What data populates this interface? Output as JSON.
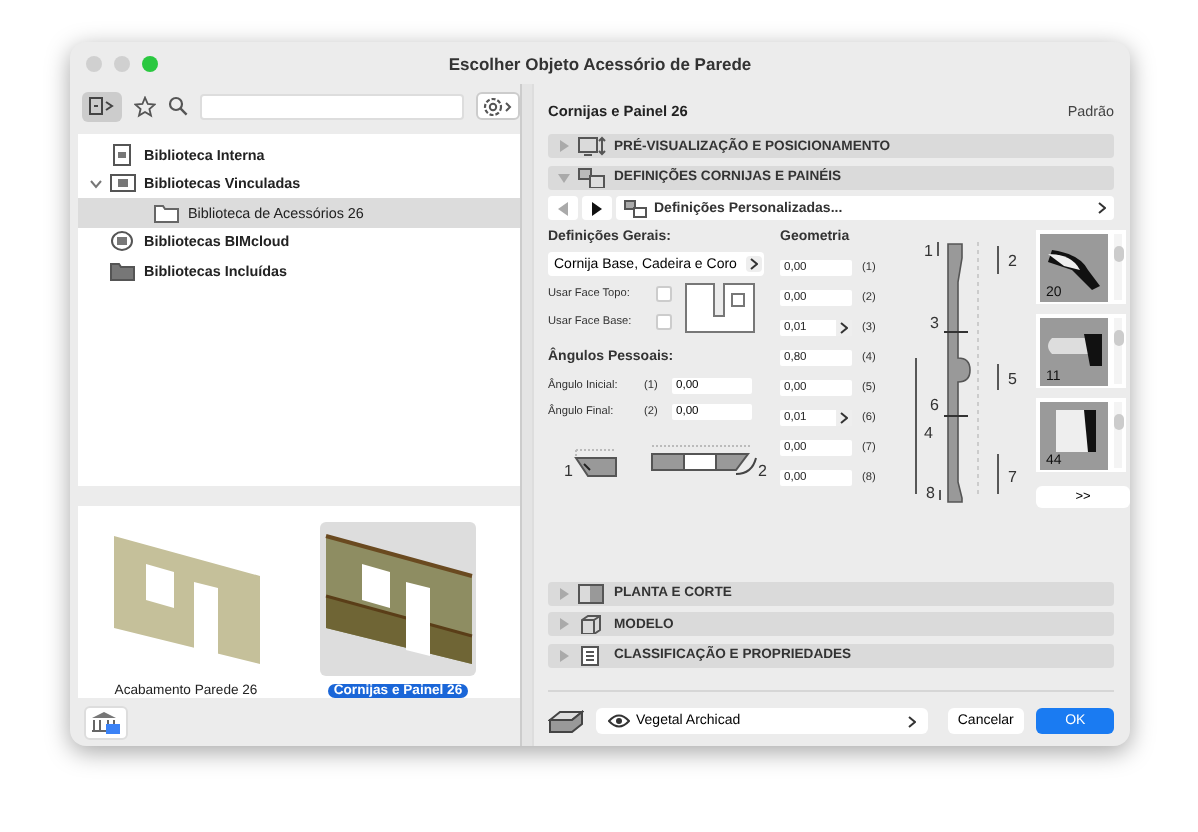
{
  "window": {
    "title": "Escolher Objeto Acessório de Parede"
  },
  "library_tree": [
    {
      "label": "Biblioteca Interna",
      "kind": "doc",
      "selected": false
    },
    {
      "label": "Bibliotecas Vinculadas",
      "kind": "linked",
      "expanded": true,
      "selected": false,
      "children": [
        {
          "label": "Biblioteca de Acessórios 26",
          "kind": "folder",
          "selected": true
        }
      ]
    },
    {
      "label": "Bibliotecas BIMcloud",
      "kind": "cloud",
      "selected": false
    },
    {
      "label": "Bibliotecas Incluídas",
      "kind": "darkfolder",
      "selected": false
    }
  ],
  "objects": [
    {
      "label": "Acabamento Parede 26",
      "kind": "plain",
      "selected": false
    },
    {
      "label": "Cornijas e Painel 26",
      "kind": "paneled",
      "selected": true
    }
  ],
  "settings": {
    "object_name": "Cornijas e Painel 26",
    "default_label": "Padrão",
    "sections": [
      {
        "title": "PRÉ-VISUALIZAÇÃO E POSICIONAMENTO",
        "kind": "preview",
        "expanded": false
      },
      {
        "title": "DEFINIÇÕES CORNIJAS E PAINÉIS",
        "kind": "settings",
        "expanded": true
      },
      {
        "title": "PLANTA E CORTE",
        "kind": "plan",
        "expanded": false
      },
      {
        "title": "MODELO",
        "kind": "model",
        "expanded": false
      },
      {
        "title": "CLASSIFICAÇÃO E PROPRIEDADES",
        "kind": "class",
        "expanded": false
      }
    ],
    "nav": {
      "prev_disabled": true,
      "next_disabled": false,
      "page": "Definições Personalizadas..."
    },
    "general": {
      "heading": "Definições Gerais:",
      "type": "Cornija Base, Cadeira e Coro",
      "options": [
        {
          "label": "Usar Face Topo:",
          "checked": false
        },
        {
          "label": "Usar Face Base:",
          "checked": false
        }
      ]
    },
    "angles": {
      "heading": "Ângulos Pessoais:",
      "fields": [
        {
          "label": "Ângulo Inicial:",
          "index": "(1)",
          "value": "0,00"
        },
        {
          "label": "Ângulo Final:",
          "index": "(2)",
          "value": "0,00"
        }
      ],
      "diagram_labels": [
        "1",
        "2"
      ]
    },
    "geometry": {
      "heading": "Geometria",
      "fields": [
        {
          "value": "0,00",
          "index": "(1)",
          "picker": false
        },
        {
          "value": "0,00",
          "index": "(2)",
          "picker": false
        },
        {
          "value": "0,01",
          "index": "(3)",
          "picker": true
        },
        {
          "value": "0,80",
          "index": "(4)",
          "picker": false
        },
        {
          "value": "0,00",
          "index": "(5)",
          "picker": false
        },
        {
          "value": "0,01",
          "index": "(6)",
          "picker": true
        },
        {
          "value": "0,00",
          "index": "(7)",
          "picker": false
        },
        {
          "value": "0,00",
          "index": "(8)",
          "picker": false
        }
      ],
      "diagram_labels": [
        "1",
        "2",
        "3",
        "5",
        "6",
        "4",
        "7",
        "8"
      ]
    },
    "profiles": [
      {
        "number": "20",
        "kind": "cornice"
      },
      {
        "number": "11",
        "kind": "chair"
      },
      {
        "number": "44",
        "kind": "base"
      }
    ],
    "more_button": ">>"
  },
  "footer": {
    "layer": "Vegetal Archicad",
    "buttons": [
      {
        "label": "Cancelar",
        "kind": "normal"
      },
      {
        "label": "OK",
        "kind": "default"
      }
    ]
  }
}
